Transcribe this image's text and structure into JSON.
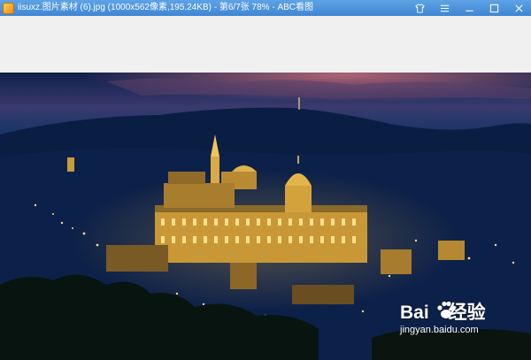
{
  "window": {
    "title": "iisuxz.图片素材 (6).jpg (1000x562像素,195.24KB) - 第6/7张 78% - ABC看图",
    "accent": "#4b92dc"
  },
  "icons": {
    "app": "abc-viewer-app-icon",
    "skin": "shirt-icon",
    "menu": "hamburger-menu-icon",
    "minimize": "minimize-icon",
    "maximize": "maximize-icon",
    "close": "close-icon"
  },
  "watermark": {
    "brand_left": "Bai",
    "brand_right": "经验",
    "url": "jingyan.baidu.com"
  }
}
